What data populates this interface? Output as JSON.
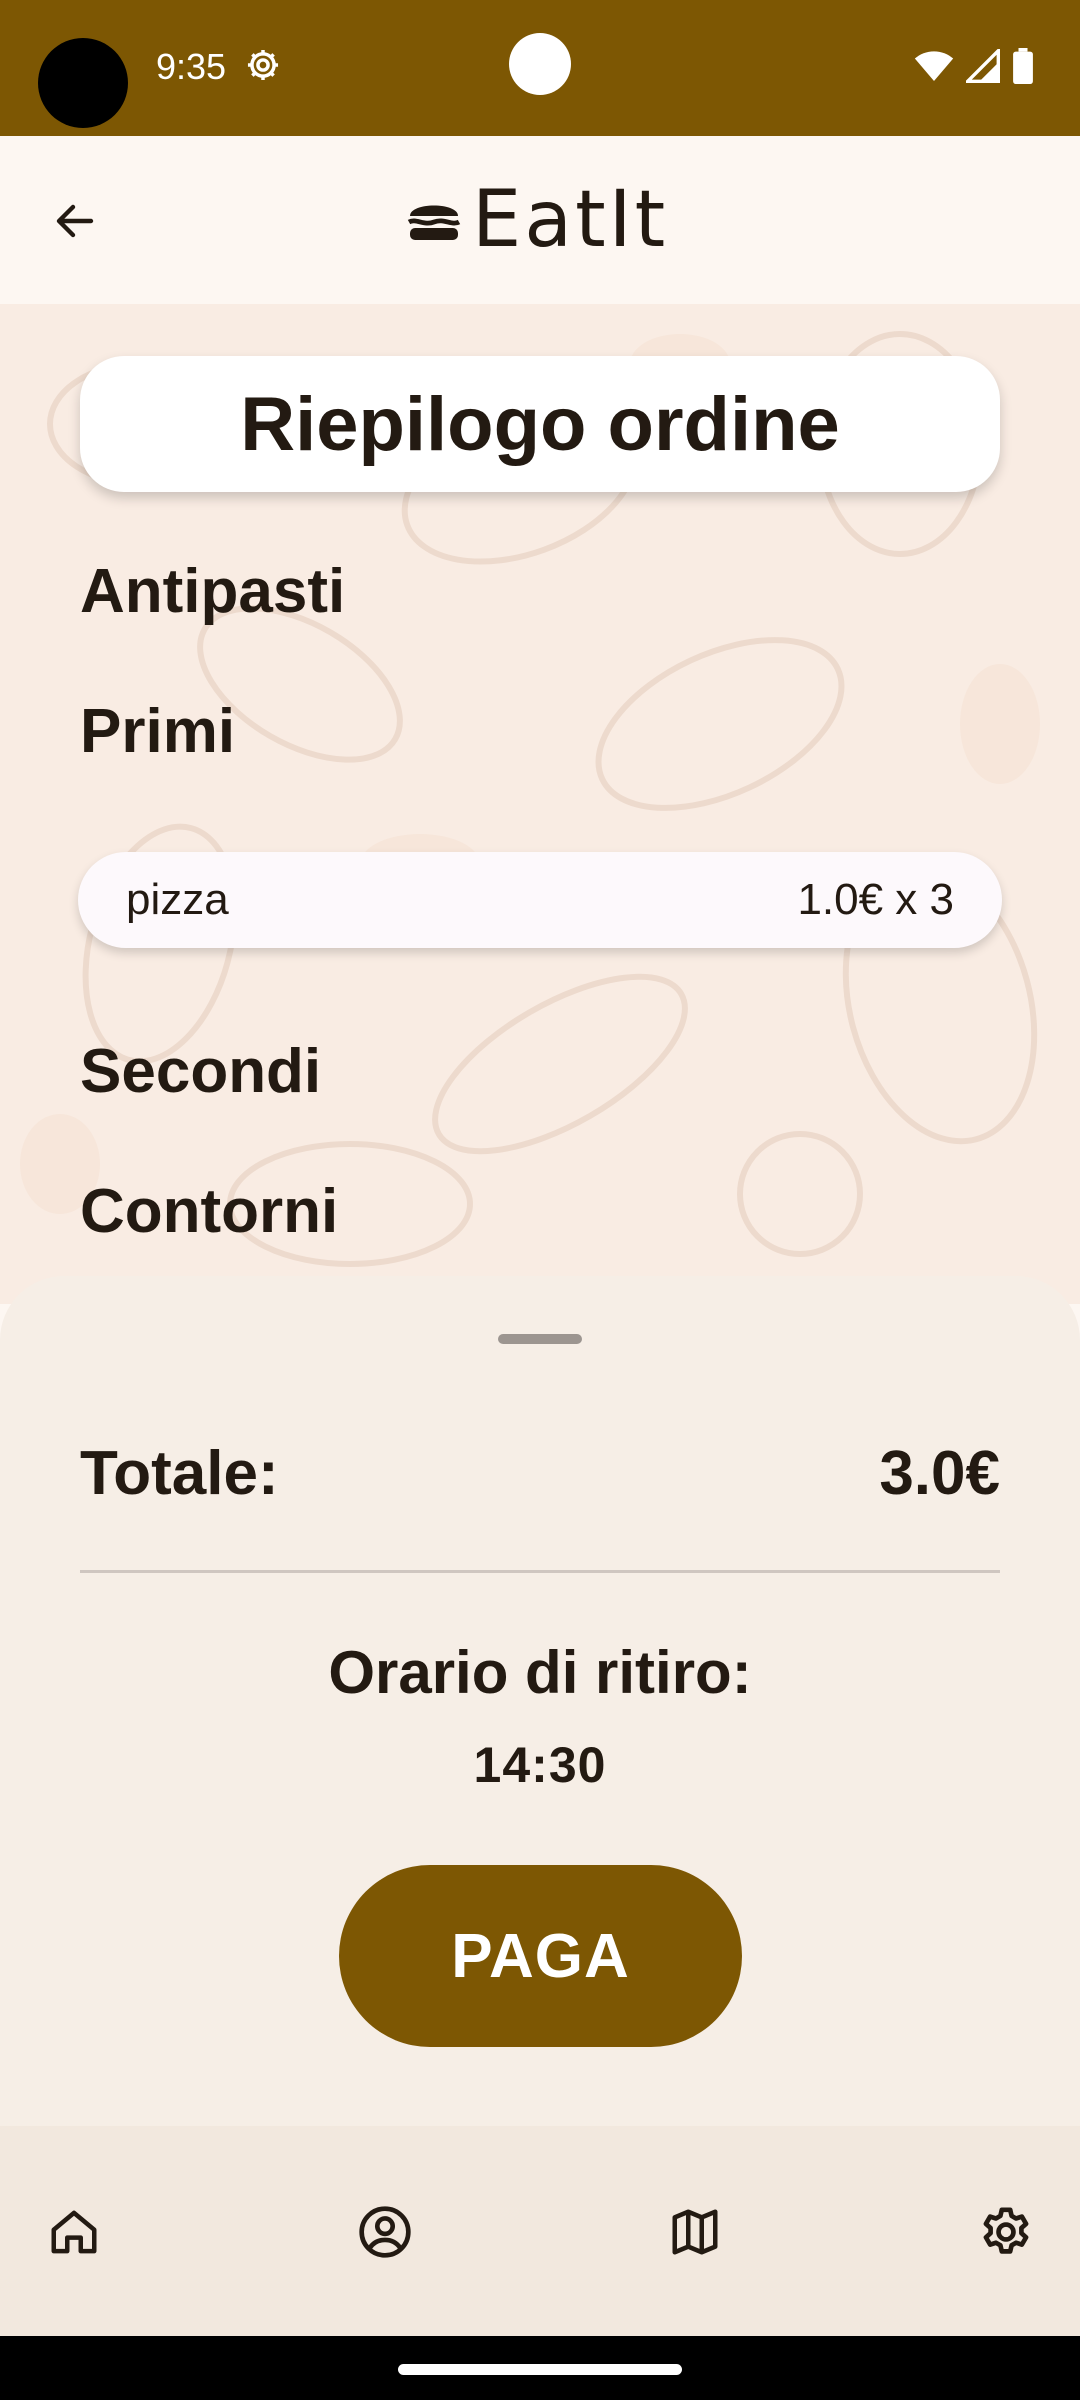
{
  "status_bar": {
    "time": "9:35",
    "icons": [
      "settings-gear-icon",
      "wifi-icon",
      "cellular-signal-icon",
      "battery-icon"
    ],
    "background": "#7d5703"
  },
  "app_bar": {
    "back_icon": "arrow-back-icon",
    "brand_icon": "burger-icon",
    "brand_name": "EatIt"
  },
  "main": {
    "title": "Riepilogo ordine",
    "sections": [
      {
        "name": "Antipasti",
        "items": []
      },
      {
        "name": "Primi",
        "items": [
          {
            "name": "pizza",
            "price": "1.0€ x 3"
          }
        ]
      },
      {
        "name": "Secondi",
        "items": []
      },
      {
        "name": "Contorni",
        "items": []
      }
    ]
  },
  "summary": {
    "total_label": "Totale:",
    "total_value": "3.0€",
    "pickup_label": "Orario di ritiro:",
    "pickup_time": "14:30",
    "pay_label": "PAGA"
  },
  "bottom_nav": {
    "items": [
      {
        "icon": "home-icon"
      },
      {
        "icon": "account-icon"
      },
      {
        "icon": "map-icon"
      },
      {
        "icon": "settings-icon"
      }
    ]
  },
  "colors": {
    "accent": "#7d5703",
    "surface": "#fdf7f2",
    "sheet": "#f6eee6",
    "text": "#231a12"
  }
}
